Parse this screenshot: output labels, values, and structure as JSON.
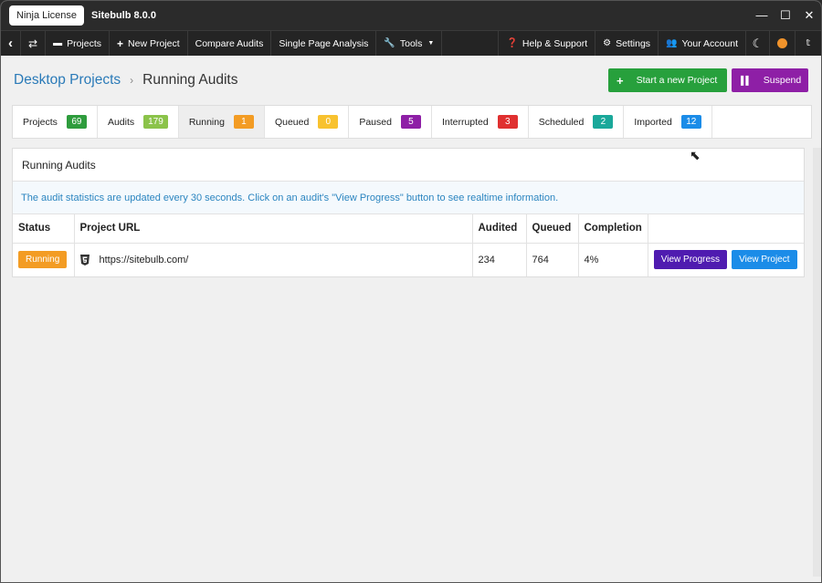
{
  "titlebar": {
    "license": "Ninja License",
    "app_title": "Sitebulb 8.0.0",
    "minimize": "—",
    "maximize": "☐",
    "close": "✕"
  },
  "nav": {
    "back_icon": "‹",
    "swap_icon": "⇄",
    "projects": "Projects",
    "new_project": "New Project",
    "compare_audits": "Compare Audits",
    "single_page_analysis": "Single Page Analysis",
    "tools": "Tools",
    "help_support": "Help & Support",
    "settings": "Settings",
    "your_account": "Your Account",
    "moon_icon": "☾",
    "twitter_icon": "🐦"
  },
  "breadcrumb": {
    "link": "Desktop Projects",
    "separator": "›",
    "current": "Running Audits"
  },
  "buttons": {
    "start_new_project": "Start a new Project",
    "suspend": "Suspend"
  },
  "tabs": [
    {
      "label": "Projects",
      "count": "69",
      "color": "#2e9c3d"
    },
    {
      "label": "Audits",
      "count": "179",
      "color": "#8bc34a"
    },
    {
      "label": "Running",
      "count": "1",
      "color": "#f39c24"
    },
    {
      "label": "Queued",
      "count": "0",
      "color": "#f8c22f"
    },
    {
      "label": "Paused",
      "count": "5",
      "color": "#8e1fa6"
    },
    {
      "label": "Interrupted",
      "count": "3",
      "color": "#e03030"
    },
    {
      "label": "Scheduled",
      "count": "2",
      "color": "#1aa89a"
    },
    {
      "label": "Imported",
      "count": "12",
      "color": "#1b8ce8"
    }
  ],
  "panel": {
    "title": "Running Audits",
    "note": "The audit statistics are updated every 30 seconds. Click on an audit's \"View Progress\" button to see realtime information."
  },
  "table": {
    "headers": [
      "Status",
      "Project URL",
      "Audited",
      "Queued",
      "Completion",
      ""
    ],
    "rows": [
      {
        "status": "Running",
        "url": "https://sitebulb.com/",
        "audited": "234",
        "queued": "764",
        "completion": "4%",
        "view_progress": "View Progress",
        "view_project": "View Project"
      }
    ]
  }
}
